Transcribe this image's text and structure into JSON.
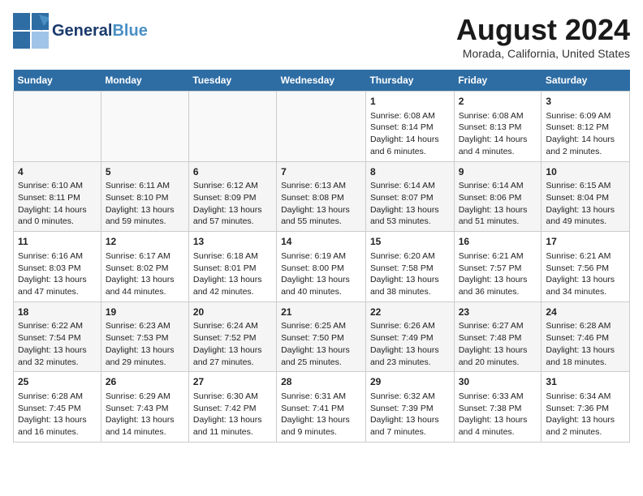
{
  "header": {
    "logo_general": "General",
    "logo_blue": "Blue",
    "main_title": "August 2024",
    "subtitle": "Morada, California, United States"
  },
  "days_of_week": [
    "Sunday",
    "Monday",
    "Tuesday",
    "Wednesday",
    "Thursday",
    "Friday",
    "Saturday"
  ],
  "weeks": [
    {
      "cells": [
        {
          "day": "",
          "empty": true
        },
        {
          "day": "",
          "empty": true
        },
        {
          "day": "",
          "empty": true
        },
        {
          "day": "",
          "empty": true
        },
        {
          "day": "1",
          "line1": "Sunrise: 6:08 AM",
          "line2": "Sunset: 8:14 PM",
          "line3": "Daylight: 14 hours",
          "line4": "and 6 minutes."
        },
        {
          "day": "2",
          "line1": "Sunrise: 6:08 AM",
          "line2": "Sunset: 8:13 PM",
          "line3": "Daylight: 14 hours",
          "line4": "and 4 minutes."
        },
        {
          "day": "3",
          "line1": "Sunrise: 6:09 AM",
          "line2": "Sunset: 8:12 PM",
          "line3": "Daylight: 14 hours",
          "line4": "and 2 minutes."
        }
      ]
    },
    {
      "cells": [
        {
          "day": "4",
          "line1": "Sunrise: 6:10 AM",
          "line2": "Sunset: 8:11 PM",
          "line3": "Daylight: 14 hours",
          "line4": "and 0 minutes."
        },
        {
          "day": "5",
          "line1": "Sunrise: 6:11 AM",
          "line2": "Sunset: 8:10 PM",
          "line3": "Daylight: 13 hours",
          "line4": "and 59 minutes."
        },
        {
          "day": "6",
          "line1": "Sunrise: 6:12 AM",
          "line2": "Sunset: 8:09 PM",
          "line3": "Daylight: 13 hours",
          "line4": "and 57 minutes."
        },
        {
          "day": "7",
          "line1": "Sunrise: 6:13 AM",
          "line2": "Sunset: 8:08 PM",
          "line3": "Daylight: 13 hours",
          "line4": "and 55 minutes."
        },
        {
          "day": "8",
          "line1": "Sunrise: 6:14 AM",
          "line2": "Sunset: 8:07 PM",
          "line3": "Daylight: 13 hours",
          "line4": "and 53 minutes."
        },
        {
          "day": "9",
          "line1": "Sunrise: 6:14 AM",
          "line2": "Sunset: 8:06 PM",
          "line3": "Daylight: 13 hours",
          "line4": "and 51 minutes."
        },
        {
          "day": "10",
          "line1": "Sunrise: 6:15 AM",
          "line2": "Sunset: 8:04 PM",
          "line3": "Daylight: 13 hours",
          "line4": "and 49 minutes."
        }
      ]
    },
    {
      "cells": [
        {
          "day": "11",
          "line1": "Sunrise: 6:16 AM",
          "line2": "Sunset: 8:03 PM",
          "line3": "Daylight: 13 hours",
          "line4": "and 47 minutes."
        },
        {
          "day": "12",
          "line1": "Sunrise: 6:17 AM",
          "line2": "Sunset: 8:02 PM",
          "line3": "Daylight: 13 hours",
          "line4": "and 44 minutes."
        },
        {
          "day": "13",
          "line1": "Sunrise: 6:18 AM",
          "line2": "Sunset: 8:01 PM",
          "line3": "Daylight: 13 hours",
          "line4": "and 42 minutes."
        },
        {
          "day": "14",
          "line1": "Sunrise: 6:19 AM",
          "line2": "Sunset: 8:00 PM",
          "line3": "Daylight: 13 hours",
          "line4": "and 40 minutes."
        },
        {
          "day": "15",
          "line1": "Sunrise: 6:20 AM",
          "line2": "Sunset: 7:58 PM",
          "line3": "Daylight: 13 hours",
          "line4": "and 38 minutes."
        },
        {
          "day": "16",
          "line1": "Sunrise: 6:21 AM",
          "line2": "Sunset: 7:57 PM",
          "line3": "Daylight: 13 hours",
          "line4": "and 36 minutes."
        },
        {
          "day": "17",
          "line1": "Sunrise: 6:21 AM",
          "line2": "Sunset: 7:56 PM",
          "line3": "Daylight: 13 hours",
          "line4": "and 34 minutes."
        }
      ]
    },
    {
      "cells": [
        {
          "day": "18",
          "line1": "Sunrise: 6:22 AM",
          "line2": "Sunset: 7:54 PM",
          "line3": "Daylight: 13 hours",
          "line4": "and 32 minutes."
        },
        {
          "day": "19",
          "line1": "Sunrise: 6:23 AM",
          "line2": "Sunset: 7:53 PM",
          "line3": "Daylight: 13 hours",
          "line4": "and 29 minutes."
        },
        {
          "day": "20",
          "line1": "Sunrise: 6:24 AM",
          "line2": "Sunset: 7:52 PM",
          "line3": "Daylight: 13 hours",
          "line4": "and 27 minutes."
        },
        {
          "day": "21",
          "line1": "Sunrise: 6:25 AM",
          "line2": "Sunset: 7:50 PM",
          "line3": "Daylight: 13 hours",
          "line4": "and 25 minutes."
        },
        {
          "day": "22",
          "line1": "Sunrise: 6:26 AM",
          "line2": "Sunset: 7:49 PM",
          "line3": "Daylight: 13 hours",
          "line4": "and 23 minutes."
        },
        {
          "day": "23",
          "line1": "Sunrise: 6:27 AM",
          "line2": "Sunset: 7:48 PM",
          "line3": "Daylight: 13 hours",
          "line4": "and 20 minutes."
        },
        {
          "day": "24",
          "line1": "Sunrise: 6:28 AM",
          "line2": "Sunset: 7:46 PM",
          "line3": "Daylight: 13 hours",
          "line4": "and 18 minutes."
        }
      ]
    },
    {
      "cells": [
        {
          "day": "25",
          "line1": "Sunrise: 6:28 AM",
          "line2": "Sunset: 7:45 PM",
          "line3": "Daylight: 13 hours",
          "line4": "and 16 minutes."
        },
        {
          "day": "26",
          "line1": "Sunrise: 6:29 AM",
          "line2": "Sunset: 7:43 PM",
          "line3": "Daylight: 13 hours",
          "line4": "and 14 minutes."
        },
        {
          "day": "27",
          "line1": "Sunrise: 6:30 AM",
          "line2": "Sunset: 7:42 PM",
          "line3": "Daylight: 13 hours",
          "line4": "and 11 minutes."
        },
        {
          "day": "28",
          "line1": "Sunrise: 6:31 AM",
          "line2": "Sunset: 7:41 PM",
          "line3": "Daylight: 13 hours",
          "line4": "and 9 minutes."
        },
        {
          "day": "29",
          "line1": "Sunrise: 6:32 AM",
          "line2": "Sunset: 7:39 PM",
          "line3": "Daylight: 13 hours",
          "line4": "and 7 minutes."
        },
        {
          "day": "30",
          "line1": "Sunrise: 6:33 AM",
          "line2": "Sunset: 7:38 PM",
          "line3": "Daylight: 13 hours",
          "line4": "and 4 minutes."
        },
        {
          "day": "31",
          "line1": "Sunrise: 6:34 AM",
          "line2": "Sunset: 7:36 PM",
          "line3": "Daylight: 13 hours",
          "line4": "and 2 minutes."
        }
      ]
    }
  ]
}
